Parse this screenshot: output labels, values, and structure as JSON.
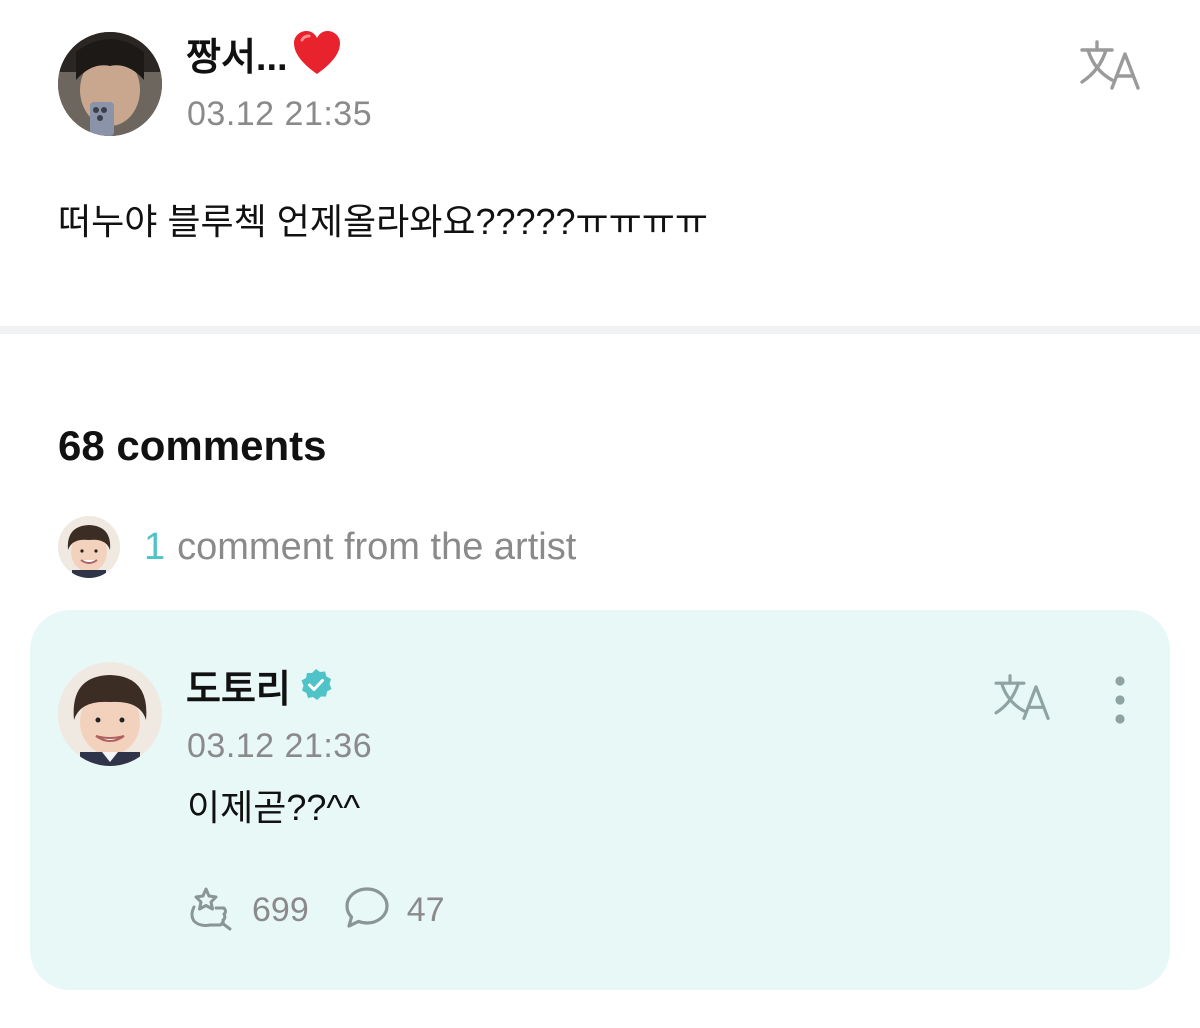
{
  "post": {
    "author": "짱서...",
    "author_emoji": "heart-emoji",
    "timestamp": "03.12 21:35",
    "body": "떠누야 블루첵 언제올라와요?????ㅠㅠㅠㅠ",
    "translate_icon": "translate-icon"
  },
  "comments": {
    "heading": "68 comments",
    "artist_summary": {
      "count": "1",
      "text": "comment from the artist"
    }
  },
  "artist_comment": {
    "author": "도토리",
    "verified_icon": "verified-badge-icon",
    "timestamp": "03.12 21:36",
    "body": "이제곧??^^",
    "likes": "699",
    "replies": "47",
    "like_icon": "like-reaction-icon",
    "reply_icon": "reply-bubble-icon",
    "more_icon": "more-vertical-icon"
  },
  "colors": {
    "card_background": "#e8f8f7",
    "accent_teal": "#4fc3c7",
    "secondary_text": "#8a8a8a",
    "heart": "#e8232e"
  }
}
